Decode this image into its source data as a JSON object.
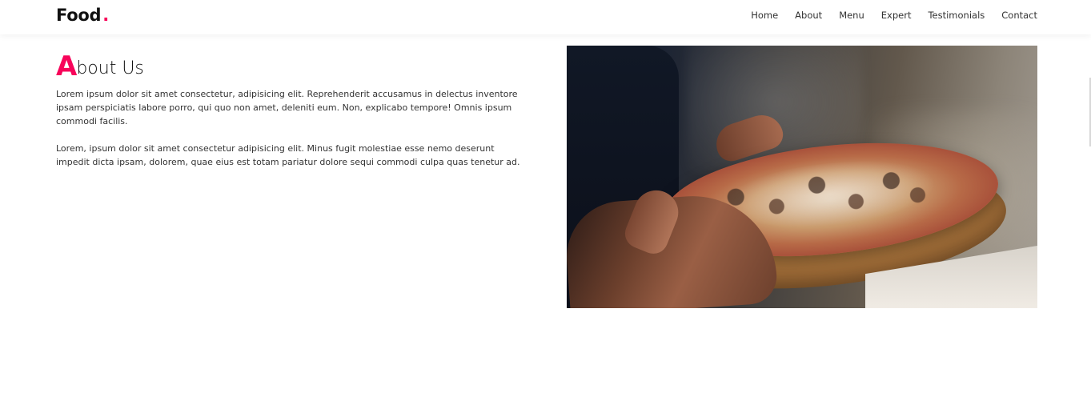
{
  "brand": {
    "name": "Food",
    "dot": "."
  },
  "nav": {
    "items": [
      "Home",
      "About",
      "Menu",
      "Expert",
      "Testimonials",
      "Contact"
    ]
  },
  "about": {
    "title_first_letter": "A",
    "title_rest": "bout Us",
    "paragraphs": [
      "Lorem ipsum dolor sit amet consectetur, adipisicing elit. Reprehenderit accusamus in delectus inventore ipsam perspiciatis labore porro, qui quo non amet, deleniti eum. Non, explicabo tempore! Omnis ipsum commodi facilis.",
      "Lorem, ipsum dolor sit amet consectetur adipisicing elit. Minus fugit molestiae esse nemo deserunt impedit dicta ipsam, dolorem, quae eius est totam pariatur dolore sequi commodi culpa quas tenetur ad."
    ]
  },
  "colors": {
    "accent": "#f7045a",
    "text": "#333333",
    "background": "#ffffff"
  }
}
